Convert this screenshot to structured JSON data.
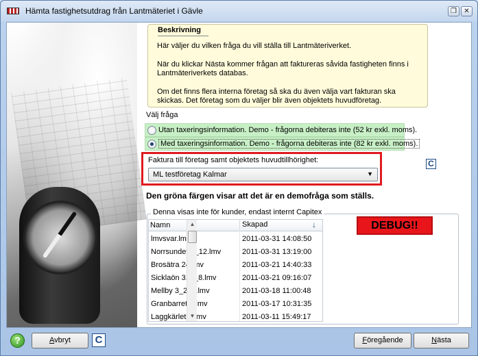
{
  "window": {
    "title": "Hämta fastighetsutdrag från Lantmäteriet i Gävle",
    "restore_symbol": "❐",
    "close_symbol": "✕"
  },
  "description": {
    "heading": "Beskrivning",
    "p1": "Här väljer du vilken fråga du vill ställa till Lantmäteriverket.",
    "p2": "När du klickar Nästa kommer frågan att faktureras såvida fastigheten finns i Lantmäteriverkets databas.",
    "p3": "Om det finns flera interna företag så ska du även välja vart fakturan ska skickas. Det företag som du väljer blir även objektets huvudföretag."
  },
  "question": {
    "label": "Välj fråga",
    "options": [
      {
        "text": "Utan taxeringsinformation. Demo - frågorna debiteras inte (52 kr exkl. moms).",
        "selected": false
      },
      {
        "text": "Med taxeringsinformation. Demo - frågorna debiteras inte (82 kr exkl. moms).",
        "selected": true
      }
    ]
  },
  "company": {
    "label": "Faktura till företag samt objektets huvudtillhörighet:",
    "selected": "ML testföretag Kalmar",
    "arrow": "▼"
  },
  "logo_letter": "C",
  "green_note": "Den gröna färgen visar att det är en demofråga som ställs.",
  "debug": {
    "caption": "Denna visas inte för kunder, endast internt Capitex",
    "badge": "DEBUG!!",
    "columns": {
      "name": "Namn",
      "date": "Skapad",
      "sort_symbol": "↓"
    },
    "rows": [
      {
        "name": "lmvsvar.lmv",
        "date": "2011-03-31 14:08:50"
      },
      {
        "name": "Norrsundet 3_12.lmv",
        "date": "2011-03-31 13:19:00"
      },
      {
        "name": "Brosätra 24.lmv",
        "date": "2011-03-21 14:40:33"
      },
      {
        "name": "Sicklaön 312_8.lmv",
        "date": "2011-03-21 09:16:07"
      },
      {
        "name": "Mellby 3_209.lmv",
        "date": "2011-03-18 11:00:48"
      },
      {
        "name": "Granbarret 8.lmv",
        "date": "2011-03-17 10:31:35"
      },
      {
        "name": "Laggkärlet 6.lmv",
        "date": "2011-03-11 15:49:17"
      }
    ]
  },
  "buttons": {
    "help": "?",
    "cancel_key": "A",
    "cancel_rest": "vbryt",
    "prev_key": "F",
    "prev_rest": "öregående",
    "next_key": "N",
    "next_rest": "ästa"
  },
  "colors": {
    "demo_green": "#c8f0c6",
    "highlight_red": "#e0191e",
    "description_bg": "#fffbdb",
    "debug_red": "#e8161b"
  }
}
